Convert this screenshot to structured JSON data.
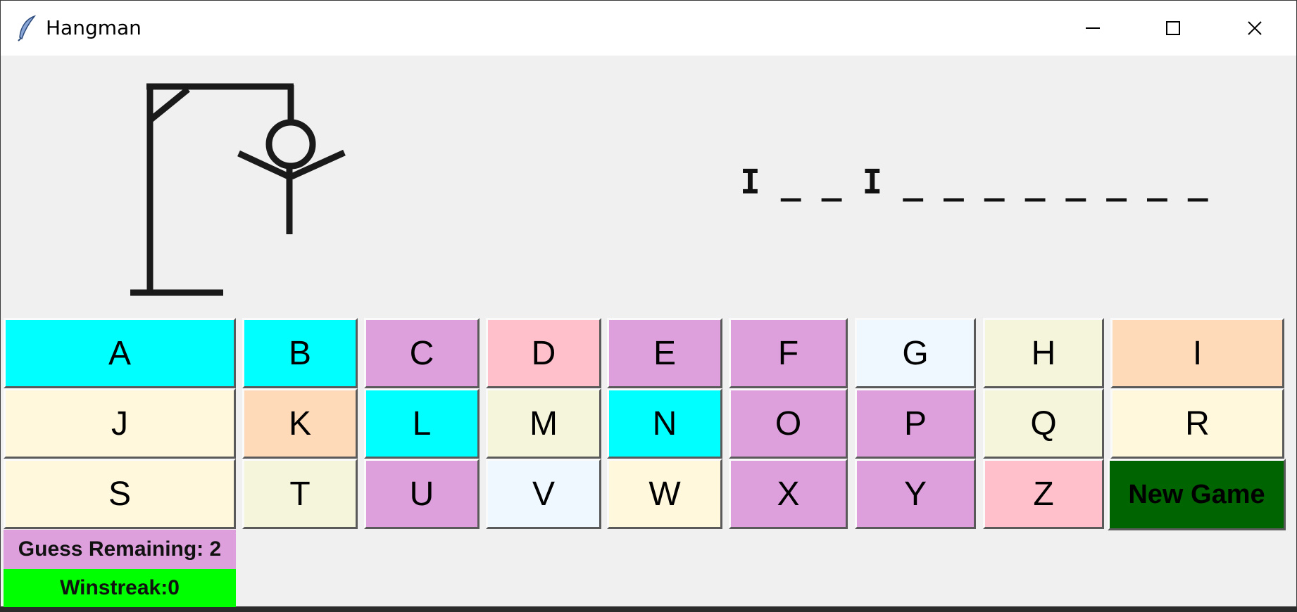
{
  "window": {
    "title": "Hangman",
    "icon": "feather-icon",
    "controls": [
      "minimize-icon",
      "maximize-icon",
      "close-icon"
    ]
  },
  "game": {
    "word_display": "I _ _ I _ _ _ _ _ _ _ _",
    "guesses_remaining_label": "Guess Remaining: 2",
    "winstreak_label": "Winstreak:0"
  },
  "keyboard": {
    "rows": [
      [
        {
          "label": "A",
          "color": "#00ffff"
        },
        {
          "label": "B",
          "color": "#00ffff"
        },
        {
          "label": "C",
          "color": "#dda0dd"
        },
        {
          "label": "D",
          "color": "#ffc0cb"
        },
        {
          "label": "E",
          "color": "#dda0dd"
        },
        {
          "label": "F",
          "color": "#dda0dd"
        },
        {
          "label": "G",
          "color": "#f0f8ff"
        },
        {
          "label": "H",
          "color": "#f5f5dc"
        },
        {
          "label": "I",
          "color": "#ffdab9"
        }
      ],
      [
        {
          "label": "J",
          "color": "#fff8dc"
        },
        {
          "label": "K",
          "color": "#ffdab9"
        },
        {
          "label": "L",
          "color": "#00ffff"
        },
        {
          "label": "M",
          "color": "#f5f5dc"
        },
        {
          "label": "N",
          "color": "#00ffff"
        },
        {
          "label": "O",
          "color": "#dda0dd"
        },
        {
          "label": "P",
          "color": "#dda0dd"
        },
        {
          "label": "Q",
          "color": "#f5f5dc"
        },
        {
          "label": "R",
          "color": "#fff8dc"
        }
      ],
      [
        {
          "label": "S",
          "color": "#fff8dc"
        },
        {
          "label": "T",
          "color": "#f5f5dc"
        },
        {
          "label": "U",
          "color": "#dda0dd"
        },
        {
          "label": "V",
          "color": "#f0f8ff"
        },
        {
          "label": "W",
          "color": "#fff8dc"
        },
        {
          "label": "X",
          "color": "#dda0dd"
        },
        {
          "label": "Y",
          "color": "#dda0dd"
        },
        {
          "label": "Z",
          "color": "#ffc0cb"
        }
      ]
    ],
    "new_game_label": "New Game",
    "new_game_color": "#006400"
  },
  "colors": {
    "guesses_bg": "#dda0dd",
    "winstreak_bg": "#00ff00"
  }
}
